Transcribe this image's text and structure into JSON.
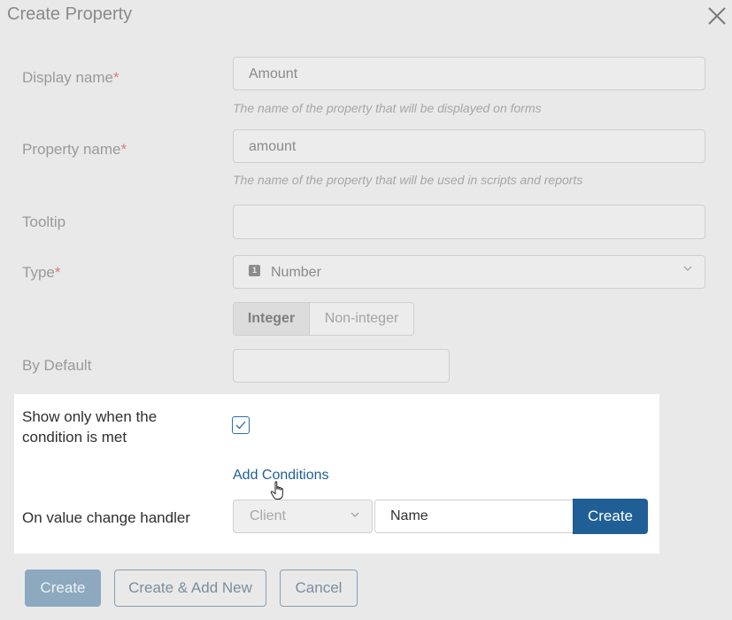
{
  "dialog": {
    "title": "Create Property",
    "close_icon": "close-icon"
  },
  "fields": {
    "display_name": {
      "label": "Display name",
      "required_mark": "*",
      "value": "Amount",
      "hint": "The name of the property that will be displayed on forms"
    },
    "property_name": {
      "label": "Property name",
      "required_mark": "*",
      "value": "amount",
      "hint": "The name of the property that will be used in scripts and reports"
    },
    "tooltip": {
      "label": "Tooltip",
      "value": ""
    },
    "type": {
      "label": "Type",
      "required_mark": "*",
      "icon_text": "1",
      "value": "Number",
      "options": [
        "Integer",
        "Non-integer"
      ],
      "selected": "Integer"
    },
    "by_default": {
      "label": "By Default",
      "value": ""
    }
  },
  "condition": {
    "label_line1": "Show only when the",
    "label_line2": "condition is met",
    "checked": true,
    "add_link": "Add Conditions"
  },
  "handler": {
    "label": "On value change handler",
    "client_select": "Client",
    "name_value": "Name",
    "create_label": "Create"
  },
  "footer": {
    "create": "Create",
    "create_add_new": "Create & Add New",
    "cancel": "Cancel"
  },
  "colors": {
    "accent": "#1f5f95",
    "required": "#e07a7a"
  }
}
